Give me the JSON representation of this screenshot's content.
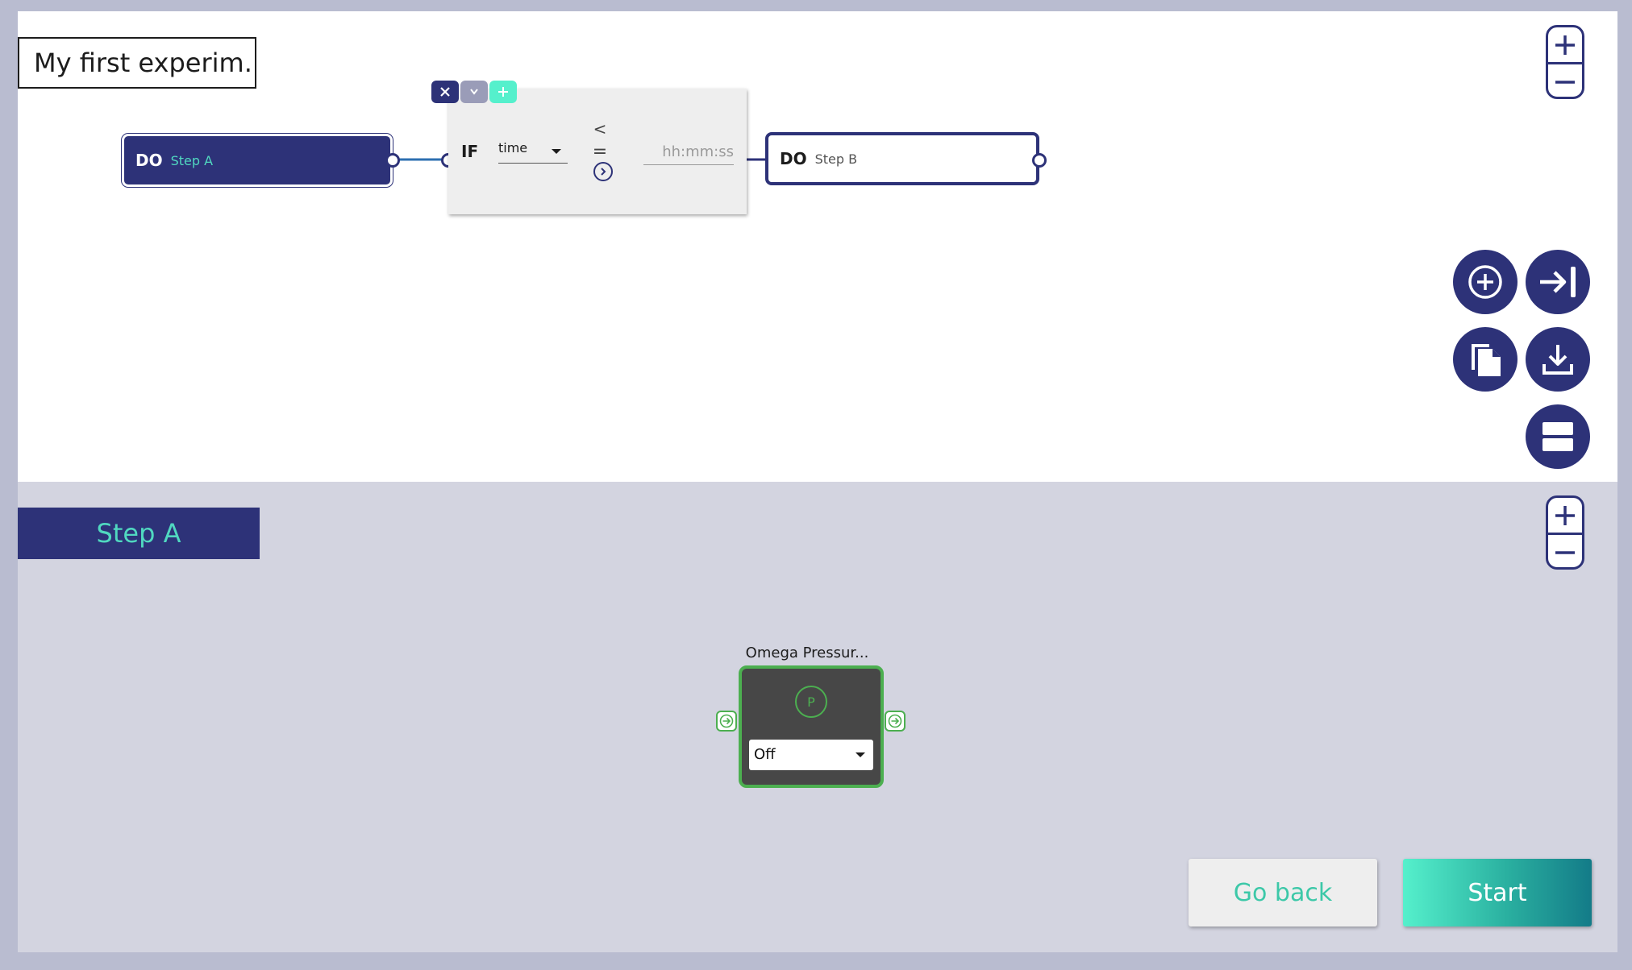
{
  "experiment_title": "My first experim...",
  "flow": {
    "step_a": {
      "keyword": "DO",
      "name": "Step A"
    },
    "step_b": {
      "keyword": "DO",
      "name": "Step B"
    },
    "condition": {
      "keyword": "IF",
      "variable": "time",
      "comparators": [
        "<",
        "=",
        ">"
      ],
      "value_placeholder": "hh:mm:ss"
    }
  },
  "step_editor": {
    "selected_step": "Step A",
    "device": {
      "label": "Omega Pressur...",
      "icon_letter": "P",
      "state": "Off"
    }
  },
  "actions": {
    "go_back": "Go back",
    "start": "Start"
  },
  "icons": {
    "fab": [
      "add-circle-icon",
      "arrow-to-end-icon",
      "copy-icon",
      "download-icon",
      "split-view-icon"
    ],
    "zoom": [
      "zoom-in-icon",
      "zoom-out-icon"
    ]
  },
  "colors": {
    "primary": "#2d3278",
    "accent": "#50d8c0",
    "device_border": "#4caf50"
  }
}
